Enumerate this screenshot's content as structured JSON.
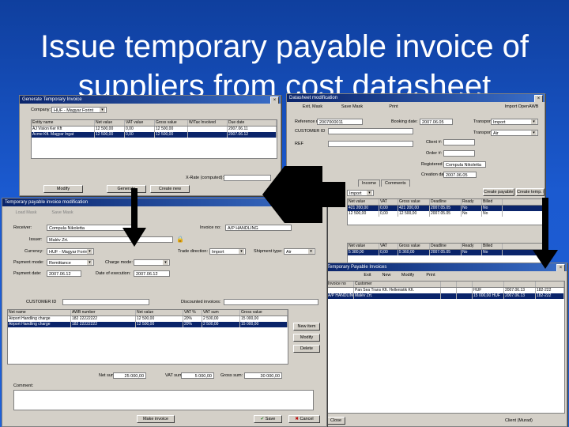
{
  "slide_title_line1": "Issue temporary payable invoice of",
  "slide_title_line2": "suppliers from cost datasheet",
  "win_generate": {
    "title": "Generate Temporary Invoice",
    "company_label": "Company:",
    "company_value": "HUF - Magyar Forint",
    "columns": [
      "Entity name",
      "Net value",
      "VAT value",
      "Gross value",
      "W/Tax Involved",
      "Due date"
    ],
    "rows": [
      [
        "AJ Vision Ker Kft",
        "12 500,00",
        "0,00",
        "12 500,00",
        "",
        "2007.06.11"
      ],
      [
        "Acme Kft. Magyar Ingat",
        "12 500,00",
        "0,00",
        "12 500,00",
        "",
        "2007.06.12"
      ]
    ],
    "fx_label": "X-Rate (computed):",
    "modify": "Modify",
    "generate": "Generate",
    "create_new": "Create new"
  },
  "win_datasheet": {
    "title": "Datasheet modification",
    "toolbar": [
      "Exit, Mask",
      "Save Mask",
      "Print",
      "Import OpenAWB"
    ],
    "ref_label": "Reference no:",
    "ref_value": "2007000011",
    "booking_label": "Booking date:",
    "booking_value": "2007.06.05",
    "transport_dir_label": "Transport direction:",
    "transport_dir_value": "Import",
    "customer_label": "CUSTOMER ID",
    "transport_meth_label": "Transport method:",
    "transport_meth_value": "Air",
    "ref2_label": "REF",
    "client_label": "Client #:",
    "order_label": "Order #:",
    "registered_label": "Registered by:",
    "registered_value": "Compula Nikoletta",
    "creation_label": "Creation date:",
    "creation_value": "2007.06.05",
    "tabs": [
      "Income",
      "Comments"
    ],
    "cost_value": "Import",
    "create_payable": "Create payable inv.",
    "create_temp": "Create temp. inv.",
    "grid1_cols": [
      "Net value",
      "VAT",
      "Gross value",
      "Deadline",
      "Ready",
      "Billed"
    ],
    "grid1_rows": [
      [
        "421 200,00",
        "0,00",
        "421 200,00",
        "2007.05.05",
        "No",
        "No"
      ],
      [
        "12 500,00",
        "0,00",
        "12 500,00",
        "2007.05.05",
        "No",
        "No"
      ]
    ],
    "grid2_cols": [
      "Net value",
      "VAT",
      "Gross value",
      "Deadline",
      "Ready",
      "Billed"
    ],
    "grid2_rows": [
      [
        "5 380,00",
        "0,00",
        "5 360,00",
        "2007.05.05",
        "No",
        "No"
      ]
    ]
  },
  "win_temp_modify": {
    "title": "Temporary payable invoice modification",
    "load_mask": "Load Mask",
    "save_mask": "Save Mask",
    "receiver_label": "Receiver:",
    "receiver_value": "Compula Nikoletta",
    "invoice_no_label": "Invoice no:",
    "invoice_no_value": "A/P HANDLING",
    "issuer_label": "Issuer:",
    "issuer_value": "Malév Zrt.",
    "currency_label": "Currency:",
    "currency_value": "HUF - Magyar Forint",
    "trade_dir_label": "Trade direction:",
    "trade_dir_value": "Import",
    "shipment_label": "Shipment type:",
    "shipment_value": "Air",
    "payment_mode_label": "Payment mode:",
    "payment_mode_value": "Remittance",
    "charge_mode_label": "Charge mode:",
    "payment_date_label": "Payment date:",
    "payment_date_value": "2007.06.12",
    "execution_label": "Date of execution:",
    "execution_value": "2007.06.12",
    "customer_id_label": "CUSTOMER ID",
    "discounted_label": "Discounted invoices:",
    "columns": [
      "Net name",
      "AWB number",
      "Net value",
      "VAT %",
      "VAT sum",
      "Gross value"
    ],
    "rows": [
      [
        "Airport Handling charge",
        "182 22222222",
        "12 500,00",
        "20%",
        "2 500,00",
        "15 000,00"
      ],
      [
        "Airport Handling charge",
        "182 22222222",
        "12 500,00",
        "20%",
        "2 500,00",
        "15 000,00"
      ]
    ],
    "new_item": "New item",
    "modify": "Modify",
    "delete": "Delete",
    "net_sum_label": "Net sum:",
    "net_sum_value": "25 000,00",
    "vat_sum_label": "VAT sum:",
    "vat_sum_value": "5 000,00",
    "gross_sum_label": "Gross sum:",
    "gross_sum_value": "30 000,00",
    "comment_label": "Comment:",
    "make_invoice": "Make invoice",
    "save": "Save",
    "cancel": "Cancel"
  },
  "win_payable_list": {
    "title": "Temporary Payable Invoices",
    "toolbar": [
      "Exit",
      "New",
      "Modify",
      "Print"
    ],
    "columns": [
      "Invoice no",
      "Customer",
      "",
      "",
      "",
      "",
      ""
    ],
    "rows": [
      [
        "",
        "Pan Sea Trans Kft. Hellenistik Kft.",
        "",
        "",
        "HUF",
        "2007.06.13",
        "182-222"
      ],
      [
        "A/P HANDLING",
        "Malév Zrt.",
        "",
        "",
        "15 000,00 HUF",
        "2007.06.13",
        "182-222"
      ]
    ],
    "close": "Close",
    "status": "Client (Murad)"
  }
}
